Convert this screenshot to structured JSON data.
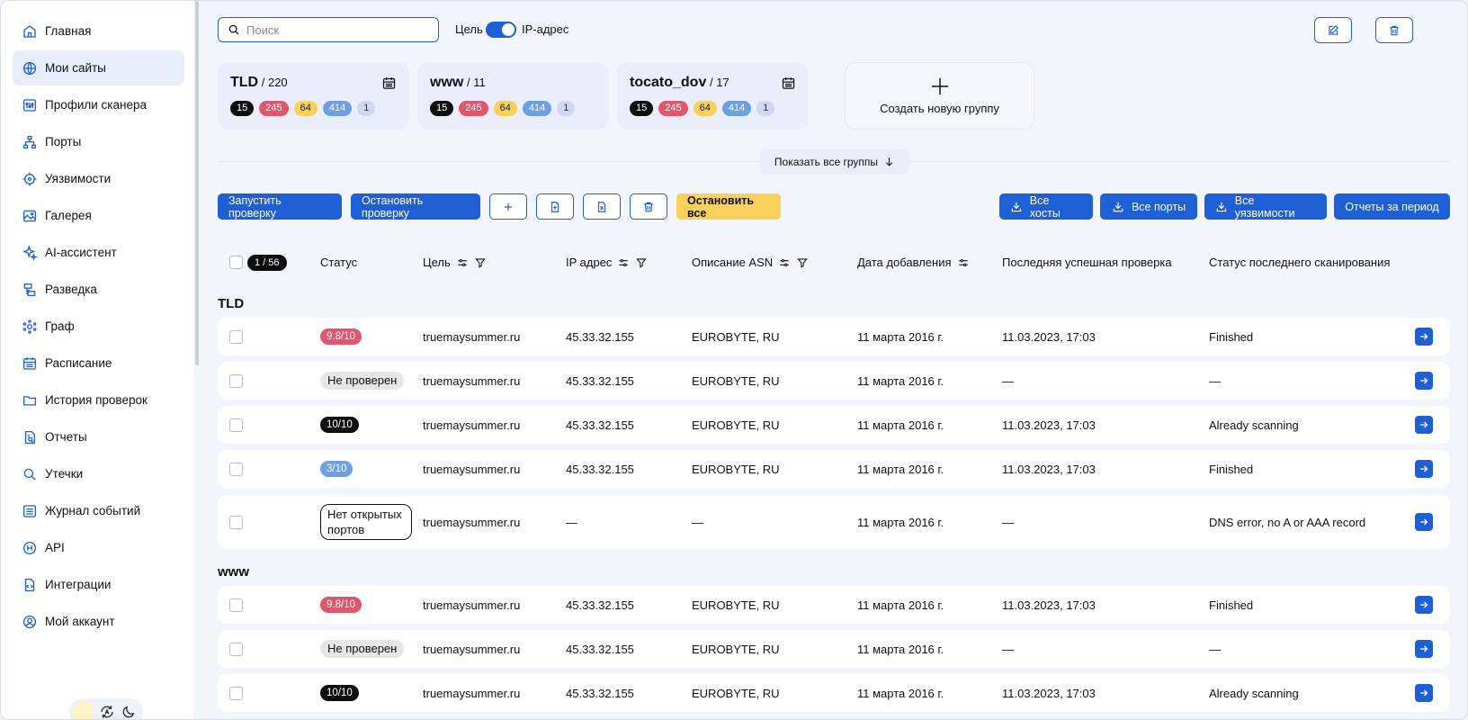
{
  "sidebar": {
    "items": [
      {
        "label": "Главная",
        "icon": "home-icon"
      },
      {
        "label": "Мои сайты",
        "icon": "globe-icon",
        "active": true
      },
      {
        "label": "Профили сканера",
        "icon": "sliders-icon"
      },
      {
        "label": "Порты",
        "icon": "network-icon"
      },
      {
        "label": "Уязвимости",
        "icon": "target-icon"
      },
      {
        "label": "Галерея",
        "icon": "image-icon"
      },
      {
        "label": "AI-ассистент",
        "icon": "sparkle-icon"
      },
      {
        "label": "Разведка",
        "icon": "hierarchy-icon"
      },
      {
        "label": "Граф",
        "icon": "graph-icon"
      },
      {
        "label": "Расписание",
        "icon": "calendar-icon"
      },
      {
        "label": "История проверок",
        "icon": "folder-icon"
      },
      {
        "label": "Отчеты",
        "icon": "report-icon"
      },
      {
        "label": "Утечки",
        "icon": "search-icon"
      },
      {
        "label": "Журнал событий",
        "icon": "list-icon"
      },
      {
        "label": "API",
        "icon": "api-icon"
      },
      {
        "label": "Интеграции",
        "icon": "file-code-icon"
      },
      {
        "label": "Мой аккаунт",
        "icon": "user-icon"
      }
    ]
  },
  "header": {
    "search_placeholder": "Поиск",
    "toggle_left": "Цель",
    "toggle_right": "IP-адрес"
  },
  "groups": [
    {
      "name": "TLD",
      "count": "/ 220",
      "badges": [
        "15",
        "245",
        "64",
        "414",
        "1"
      ]
    },
    {
      "name": "www",
      "count": "/ 11",
      "badges": [
        "15",
        "245",
        "64",
        "414",
        "1"
      ]
    },
    {
      "name": "tocato_dov",
      "count": "/ 17",
      "badges": [
        "15",
        "245",
        "64",
        "414",
        "1"
      ]
    }
  ],
  "new_group_label": "Создать новую группу",
  "show_all_label": "Показать все группы",
  "toolbar": {
    "start": "Запустить проверку",
    "stop": "Остановить проверку",
    "stop_all": "Остановить все",
    "all_hosts": "Все хосты",
    "all_ports": "Все порты",
    "all_vulns": "Все уязвимости",
    "reports_period": "Отчеты за период"
  },
  "table": {
    "selected_count": "1 / 56",
    "columns": [
      "Статус",
      "Цель",
      "IP адрес",
      "Описание ASN",
      "Дата добавления",
      "Последняя успешная проверка",
      "Статус последнего сканирования"
    ]
  },
  "sections": [
    {
      "title": "TLD",
      "rows": [
        {
          "status": "9.8/10",
          "status_type": "red",
          "target": "truemaysummer.ru",
          "ip": "45.33.32.155",
          "asn": "EUROBYTE, RU",
          "date": "11 марта 2016 г.",
          "last": "11.03.2023, 17:03",
          "scan": "Finished"
        },
        {
          "status": "Не проверен",
          "status_type": "gray",
          "target": "truemaysummer.ru",
          "ip": "45.33.32.155",
          "asn": "EUROBYTE, RU",
          "date": "11 марта 2016 г.",
          "last": "—",
          "scan": "—"
        },
        {
          "status": "10/10",
          "status_type": "black",
          "target": "truemaysummer.ru",
          "ip": "45.33.32.155",
          "asn": "EUROBYTE, RU",
          "date": "11 марта 2016 г.",
          "last": "11.03.2023, 17:03",
          "scan": "Already scanning"
        },
        {
          "status": "3/10",
          "status_type": "blue",
          "target": "truemaysummer.ru",
          "ip": "45.33.32.155",
          "asn": "EUROBYTE, RU",
          "date": "11 марта 2016 г.",
          "last": "11.03.2023, 17:03",
          "scan": "Finished"
        },
        {
          "status": "Нет открытых портов",
          "status_type": "outline",
          "target": "truemaysummer.ru",
          "ip": "—",
          "asn": "—",
          "date": "11 марта 2016 г.",
          "last": "—",
          "scan": "DNS error, no A or AAA record"
        }
      ]
    },
    {
      "title": "www",
      "rows": [
        {
          "status": "9.8/10",
          "status_type": "red",
          "target": "truemaysummer.ru",
          "ip": "45.33.32.155",
          "asn": "EUROBYTE, RU",
          "date": "11 марта 2016 г.",
          "last": "11.03.2023, 17:03",
          "scan": "Finished"
        },
        {
          "status": "Не проверен",
          "status_type": "gray",
          "target": "truemaysummer.ru",
          "ip": "45.33.32.155",
          "asn": "EUROBYTE, RU",
          "date": "11 марта 2016 г.",
          "last": "—",
          "scan": "—"
        },
        {
          "status": "10/10",
          "status_type": "black",
          "target": "truemaysummer.ru",
          "ip": "45.33.32.155",
          "asn": "EUROBYTE, RU",
          "date": "11 марта 2016 г.",
          "last": "11.03.2023, 17:03",
          "scan": "Already scanning"
        }
      ]
    }
  ],
  "colors": {
    "accent": "#1f5fd6",
    "red": "#e0566c",
    "yellow": "#f8d15a",
    "blue": "#6d9fe2",
    "black": "#0d0d0d"
  }
}
